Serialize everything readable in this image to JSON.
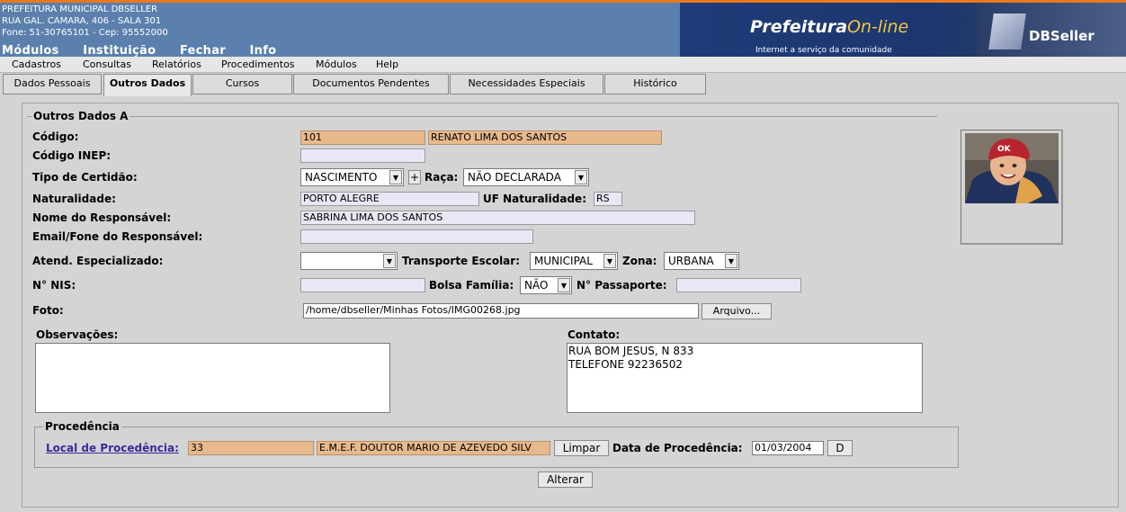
{
  "institution": {
    "name": "PREFEITURA MUNICIPAL DBSELLER",
    "address": "RUA GAL. CAMARA, 406 - SALA 301",
    "phone": "Fone: 51-30765101  -  Cep: 95552000"
  },
  "top_menu": [
    "Módulos",
    "Instituição",
    "Fechar",
    "Info"
  ],
  "brand": {
    "logo_main": "Prefeitura",
    "logo_accent": "On-line",
    "slogan": "Internet a serviço da comunidade",
    "partner": "DBSeller"
  },
  "menu_bar": [
    "Cadastros",
    "Consultas",
    "Relatórios",
    "Procedimentos",
    "Módulos",
    "Help"
  ],
  "tabs": [
    "Dados Pessoais",
    "Outros Dados",
    "Cursos",
    "Documentos Pendentes",
    "Necessidades Especiais",
    "Histórico"
  ],
  "section_a": {
    "legend": "Outros Dados A",
    "codigo_label": "Código:",
    "codigo_value": "101",
    "nome_value": "RENATO LIMA DOS SANTOS",
    "inep_label": "Código INEP:",
    "inep_value": "",
    "certidao_label": "Tipo de Certidão:",
    "certidao_value": "NASCIMENTO",
    "plus_label": "+",
    "raca_label": "Raça:",
    "raca_value": "NÃO DECLARADA",
    "naturalidade_label": "Naturalidade:",
    "naturalidade_value": "PORTO ALEGRE",
    "uf_label": "UF Naturalidade:",
    "uf_value": "RS",
    "responsavel_label": "Nome do Responsável:",
    "responsavel_value": "SABRINA LIMA DOS SANTOS",
    "email_label": "Email/Fone do Responsável:",
    "email_value": "",
    "atend_label": "Atend. Especializado:",
    "atend_value": "",
    "transporte_label": "Transporte Escolar:",
    "transporte_value": "MUNICIPAL",
    "zona_label": "Zona:",
    "zona_value": "URBANA",
    "nis_label": "N° NIS:",
    "nis_value": "",
    "bolsa_label": "Bolsa Família:",
    "bolsa_value": "NÃO",
    "passaporte_label": "N° Passaporte:",
    "passaporte_value": "",
    "foto_label": "Foto:",
    "foto_value": "/home/dbseller/Minhas Fotos/IMG00268.jpg",
    "arquivo_label": "Arquivo...",
    "obs_label": "Observações:",
    "obs_value": "",
    "contato_label": "Contato:",
    "contato_line1": "RUA BOM JESUS, N 833",
    "contato_line2": "TELEFONE 92236502"
  },
  "procedencia": {
    "legend": "Procedência",
    "local_label": "Local de Procedência:",
    "local_code": "33",
    "local_name": "E.M.E.F. DOUTOR MARIO DE AZEVEDO SILV",
    "limpar_label": "Limpar",
    "data_label": "Data de Procedência:",
    "data_value": "01/03/2004",
    "d_label": "D"
  },
  "alterar_label": "Alterar",
  "colors": {
    "header": "#5b80ad",
    "accent_bar": "#e8791e",
    "readonly_field": "#e8b98c",
    "field": "#e7e7f5",
    "link": "#3a2a9a"
  }
}
